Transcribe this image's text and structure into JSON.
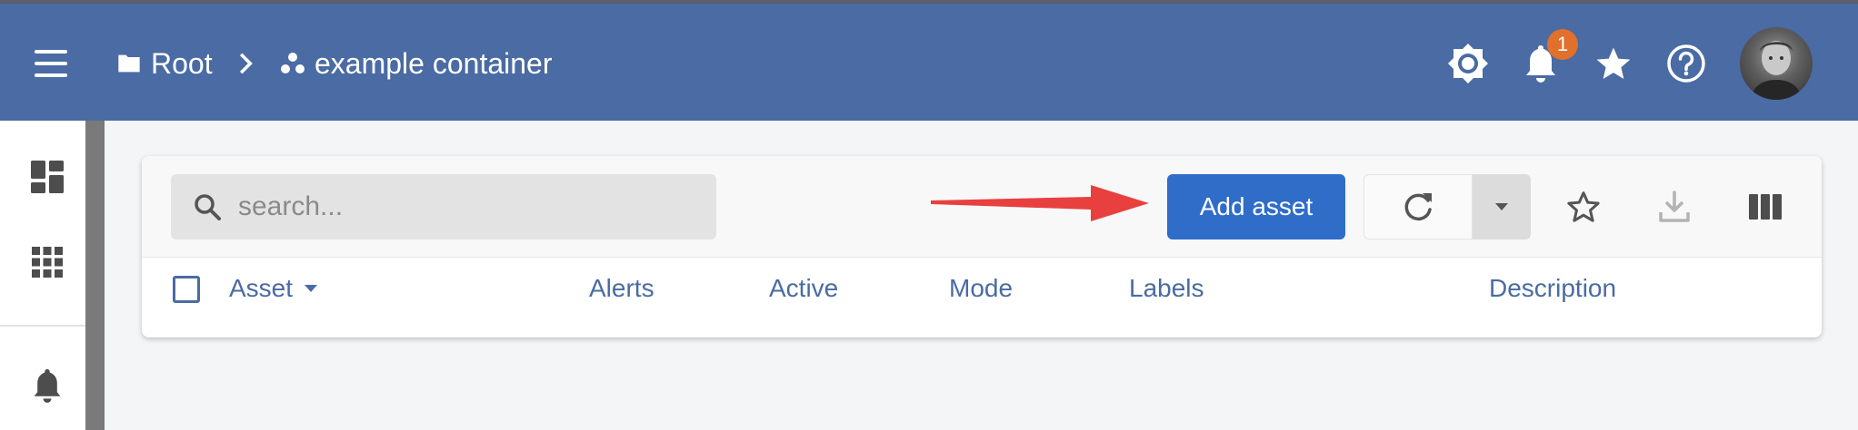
{
  "breadcrumb": {
    "root_label": "Root",
    "container_label": "example container"
  },
  "notifications": {
    "count": "1"
  },
  "icons": {
    "menu": "hamburger-menu-icon",
    "root": "folder-icon",
    "container": "container-icon",
    "theme": "brightness-icon",
    "notifications": "bell-icon",
    "favorites": "star-icon",
    "help": "help-circle-icon",
    "sidebar_dashboard": "dashboard-icon",
    "sidebar_apps": "apps-grid-icon",
    "sidebar_alerts": "bell-icon",
    "search": "search-icon",
    "refresh": "refresh-icon",
    "dropdown": "caret-down-icon",
    "favorite": "star-outline-icon",
    "download": "download-icon",
    "columns": "columns-icon"
  },
  "toolbar": {
    "search_placeholder": "search...",
    "add_label": "Add asset"
  },
  "table": {
    "columns": [
      "Asset",
      "Alerts",
      "Active",
      "Mode",
      "Labels",
      "Description"
    ]
  },
  "colors": {
    "topbar": "#4a6ba3",
    "primary_button": "#2f6dc9",
    "badge": "#e0702a",
    "annotation_arrow": "#e8403f"
  }
}
